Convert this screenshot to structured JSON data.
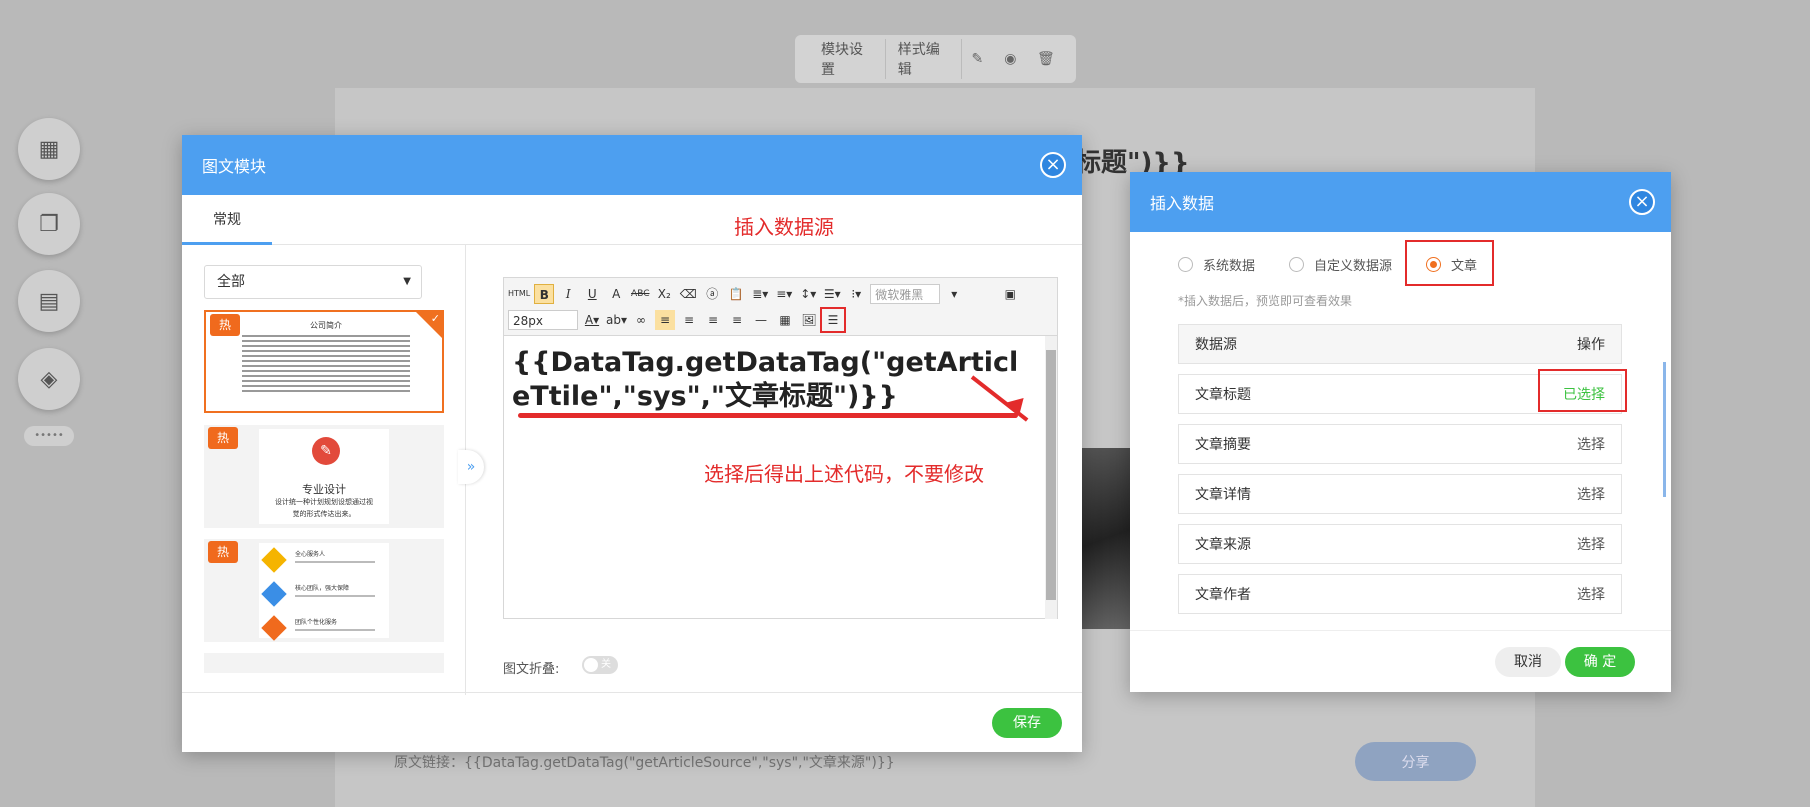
{
  "background": {
    "toolbar": {
      "module_settings": "模块设置",
      "style_edit": "样式编辑"
    },
    "title_fragment": "标题\")}}",
    "footer_text": "原文链接：{{DataTag.getDataTag(\"getArticleSource\",\"sys\",\"文章来源\")}}",
    "share_label": "分享"
  },
  "modal1": {
    "title": "图文模块",
    "tab_label": "常规",
    "annotation_top": "插入数据源",
    "category_select": "全部",
    "templates": [
      {
        "badge": "热",
        "title": "公司简介"
      },
      {
        "badge": "热",
        "title": "专业设计",
        "line1": "设计统一种计划规划设想通过视",
        "line2": "觉的形式传达出来。"
      },
      {
        "badge": "热",
        "items": [
          "全心服务人",
          "核心团队，强大保障",
          "团队个性化服务"
        ]
      }
    ],
    "toolbar": {
      "html": "HTML",
      "font_family": "微软雅黑",
      "font_size": "28px"
    },
    "editor_content": "{{DataTag.getDataTag(\"getArticleTtile\",\"sys\",\"文章标题\")}}",
    "annotation_body": "选择后得出上述代码，不要修改",
    "fold_label": "图文折叠:",
    "fold_toggle": "关",
    "save_label": "保存"
  },
  "modal2": {
    "title": "插入数据",
    "radios": [
      {
        "label": "系统数据",
        "checked": false
      },
      {
        "label": "自定义数据源",
        "checked": false
      },
      {
        "label": "文章",
        "checked": true
      }
    ],
    "hint": "*插入数据后，预览即可查看效果",
    "table": {
      "headers": [
        "数据源",
        "操作"
      ],
      "rows": [
        {
          "name": "文章标题",
          "op": "已选择"
        },
        {
          "name": "文章摘要",
          "op": "选择"
        },
        {
          "name": "文章详情",
          "op": "选择"
        },
        {
          "name": "文章来源",
          "op": "选择"
        },
        {
          "name": "文章作者",
          "op": "选择"
        }
      ]
    },
    "cancel_label": "取消",
    "ok_label": "确 定"
  },
  "colors": {
    "header_blue": "#4d9ff0",
    "green": "#3cc240",
    "hot_orange": "#f06a1d",
    "annotation_red": "#e32b2b"
  }
}
